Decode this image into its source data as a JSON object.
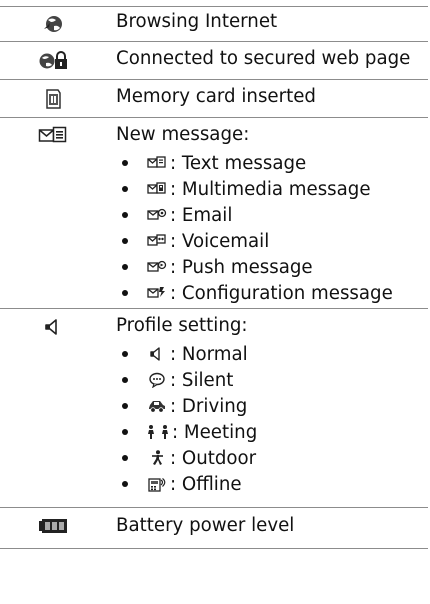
{
  "rows": [
    {
      "icon": "globe-icon",
      "text": "Browsing Internet"
    },
    {
      "icon": "secure-globe-lock-icon",
      "text": "Connected to secured web page"
    },
    {
      "icon": "memory-card-icon",
      "text": "Memory card inserted"
    },
    {
      "icon": "new-message-icon",
      "text": "New message:",
      "items": [
        {
          "icon": "text-message-icon",
          "text": ": Text message"
        },
        {
          "icon": "multimedia-message-icon",
          "text": ": Multimedia message"
        },
        {
          "icon": "email-icon",
          "text": ": Email"
        },
        {
          "icon": "voicemail-icon",
          "text": ": Voicemail"
        },
        {
          "icon": "push-message-icon",
          "text": ": Push message"
        },
        {
          "icon": "configuration-message-icon",
          "text": ": Configuration message"
        }
      ]
    },
    {
      "icon": "speaker-icon",
      "text": "Profile setting:",
      "items": [
        {
          "icon": "normal-speaker-icon",
          "text": ": Normal"
        },
        {
          "icon": "silent-icon",
          "text": ": Silent"
        },
        {
          "icon": "driving-car-icon",
          "text": ": Driving"
        },
        {
          "icon": "meeting-icon",
          "text": ": Meeting"
        },
        {
          "icon": "outdoor-person-icon",
          "text": ": Outdoor"
        },
        {
          "icon": "offline-icon",
          "text": ": Offline"
        }
      ]
    },
    {
      "icon": "battery-icon",
      "text": "Battery power level"
    }
  ]
}
